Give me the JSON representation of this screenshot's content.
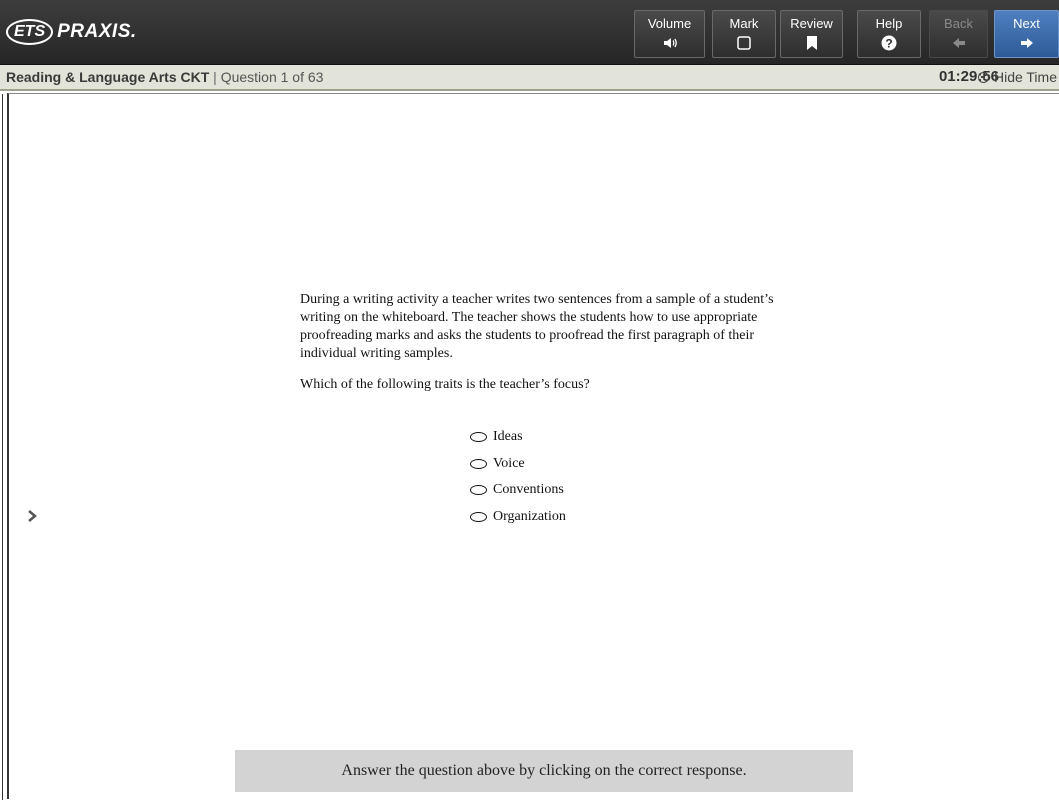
{
  "header": {
    "logo_ets": "ETS",
    "logo_praxis": "PRAXIS.",
    "buttons": {
      "volume": "Volume",
      "mark": "Mark",
      "review": "Review",
      "help": "Help",
      "back": "Back",
      "next": "Next"
    },
    "icons": {
      "volume": "speaker-icon",
      "mark": "checkbox-icon",
      "review": "bookmark-icon",
      "help": "question-circle-icon",
      "back": "arrow-left-icon",
      "next": "arrow-right-icon"
    }
  },
  "infobar": {
    "section": "Reading & Language Arts CKT",
    "separator": "|",
    "question_counter": "Question 1 of 63",
    "timer": "01:29:56",
    "hide_time": "Hide Time"
  },
  "question": {
    "stem": "During a writing activity a teacher writes two sentences from a sample of a student’s writing on the whiteboard. The teacher shows the students how to use appropriate proofreading marks and asks the students to proofread the first paragraph of their individual writing samples.",
    "prompt": "Which of the following traits is the teacher’s focus?",
    "options": [
      "Ideas",
      "Voice",
      "Conventions",
      "Organization"
    ]
  },
  "instruction": "Answer the question above by clicking on the correct response.",
  "colors": {
    "header_bg": "#2e2e2e",
    "infobar_bg": "#e2e3d9",
    "next_button": "#3a6aa8",
    "instruction_bg": "#d3d3d3"
  }
}
